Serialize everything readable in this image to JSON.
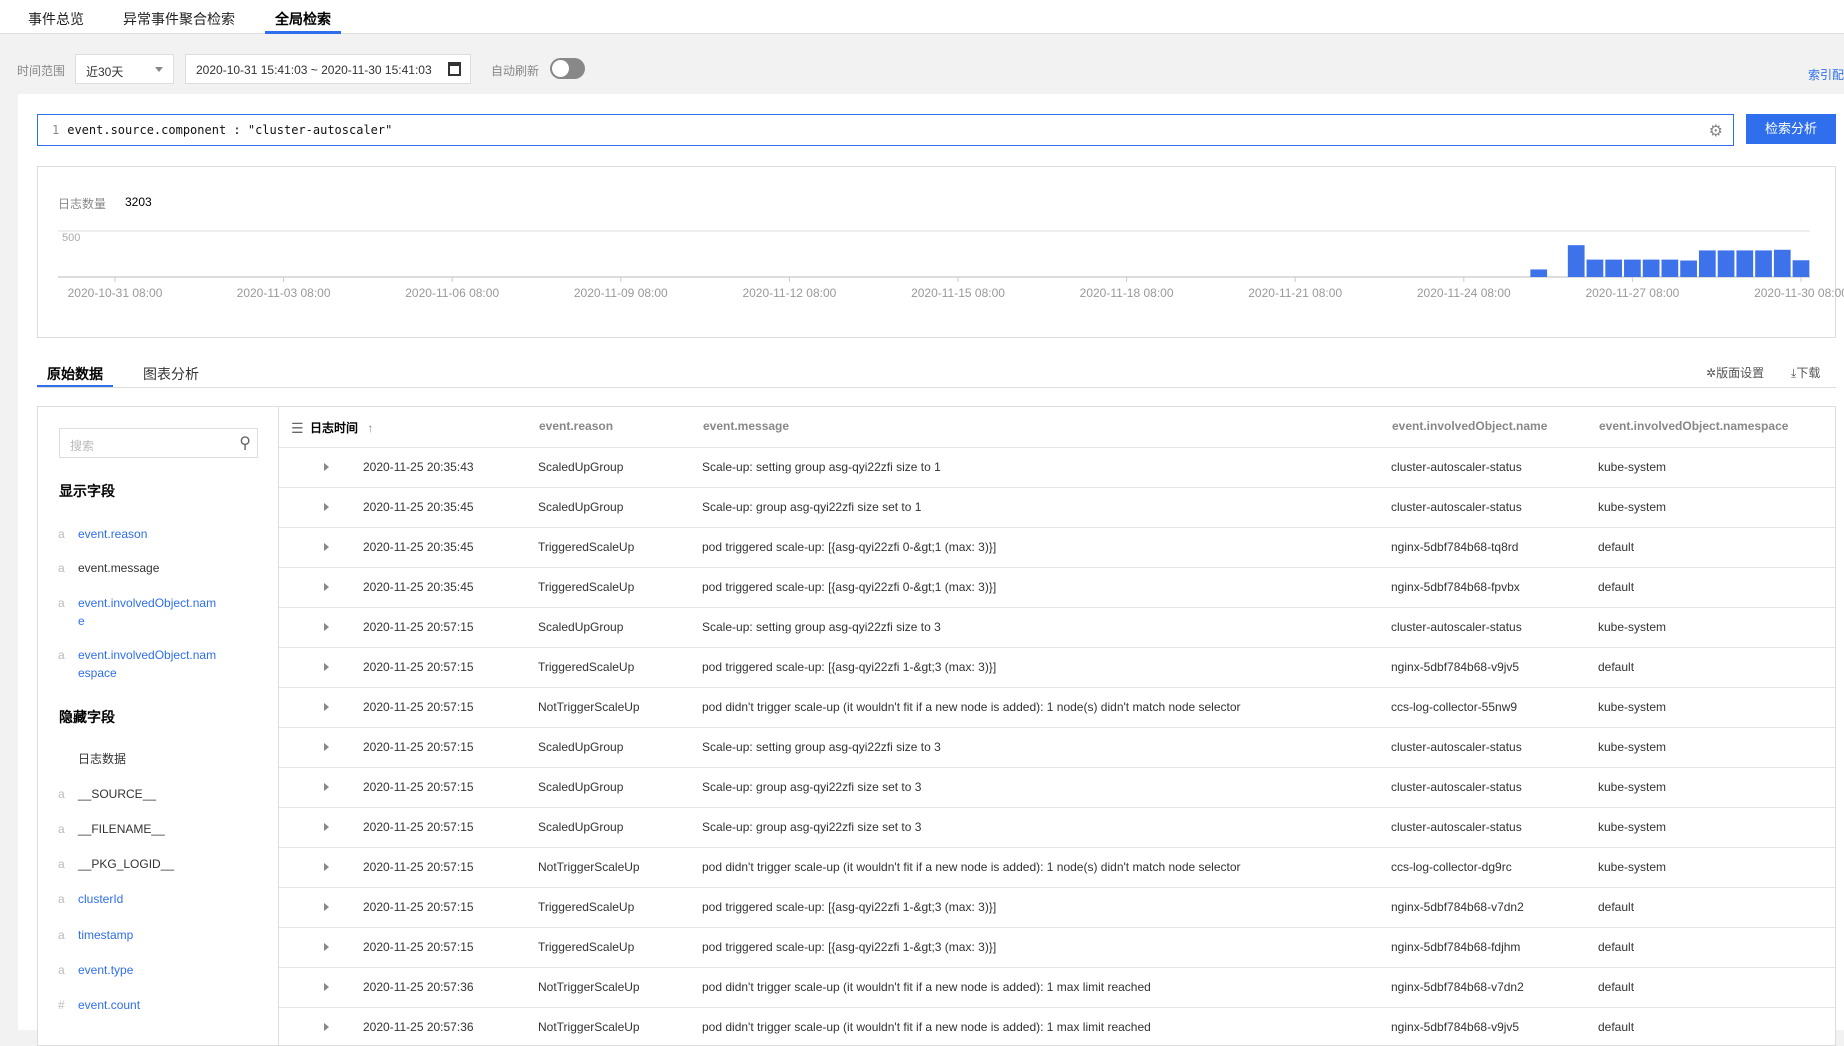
{
  "top_tabs": [
    {
      "label": "事件总览"
    },
    {
      "label": "异常事件聚合检索"
    },
    {
      "label": "全局检索",
      "active": true
    }
  ],
  "filter": {
    "time_label": "时间范围",
    "range_select": "近30天",
    "date_range": "2020-10-31 15:41:03 ~ 2020-11-30 15:41:03",
    "auto_refresh_label": "自动刷新",
    "auto_refresh_on": false,
    "index_link": "索引配"
  },
  "query": {
    "line_no": "1",
    "text": "event.source.component : \"cluster-autoscaler\"",
    "search_button": "检索分析"
  },
  "summary": {
    "count_label": "日志数量",
    "count": "3203"
  },
  "chart_data": {
    "type": "bar",
    "ylabel": "",
    "xlabel": "",
    "y_ticks": [
      500
    ],
    "grid": true,
    "x_tick_labels": [
      "2020-10-31 08:00",
      "2020-11-03 08:00",
      "2020-11-06 08:00",
      "2020-11-09 08:00",
      "2020-11-12 08:00",
      "2020-11-15 08:00",
      "2020-11-18 08:00",
      "2020-11-21 08:00",
      "2020-11-24 08:00",
      "2020-11-27 08:00",
      "2020-11-30 08:00"
    ],
    "x": [
      "2020-11-25 12:00",
      "2020-11-25 20:00",
      "2020-11-26 04:00",
      "2020-11-26 12:00",
      "2020-11-26 20:00",
      "2020-11-27 04:00",
      "2020-11-27 12:00",
      "2020-11-27 20:00",
      "2020-11-28 04:00",
      "2020-11-28 12:00",
      "2020-11-28 20:00",
      "2020-11-29 04:00",
      "2020-11-29 12:00",
      "2020-11-29 20:00",
      "2020-11-30 04:00"
    ],
    "values": [
      82,
      0,
      346,
      189,
      189,
      189,
      189,
      189,
      179,
      289,
      289,
      289,
      289,
      296,
      182
    ],
    "color": "#3d72eb"
  },
  "view_tabs": [
    {
      "label": "原始数据",
      "active": true
    },
    {
      "label": "图表分析"
    }
  ],
  "actions": {
    "layout_settings": "版面设置",
    "download": "下载"
  },
  "sidebar": {
    "search_placeholder": "搜索",
    "shown_title": "显示字段",
    "shown": [
      {
        "type": "a",
        "name": "event.reason",
        "active": true
      },
      {
        "type": "a",
        "name": "event.message",
        "active": false
      },
      {
        "type": "a",
        "name": "event.involvedObject.name",
        "active": true
      },
      {
        "type": "a",
        "name": "event.involvedObject.namespace",
        "active": true
      }
    ],
    "hidden_title": "隐藏字段",
    "hidden": [
      {
        "type": "",
        "name": "日志数据",
        "active": false
      },
      {
        "type": "a",
        "name": "__SOURCE__",
        "active": false
      },
      {
        "type": "a",
        "name": "__FILENAME__",
        "active": false
      },
      {
        "type": "a",
        "name": "__PKG_LOGID__",
        "active": false
      },
      {
        "type": "a",
        "name": "clusterId",
        "active": true
      },
      {
        "type": "a",
        "name": "timestamp",
        "active": true
      },
      {
        "type": "a",
        "name": "event.type",
        "active": true
      },
      {
        "type": "#",
        "name": "event.count",
        "active": true
      }
    ]
  },
  "table": {
    "columns": [
      "日志时间",
      "event.reason",
      "event.message",
      "event.involvedObject.name",
      "event.involvedObject.namespace"
    ],
    "sort_icon": "arrow-up",
    "rows": [
      [
        "2020-11-25 20:35:43",
        "ScaledUpGroup",
        "Scale-up: setting group asg-qyi22zfi size to 1",
        "cluster-autoscaler-status",
        "kube-system"
      ],
      [
        "2020-11-25 20:35:45",
        "ScaledUpGroup",
        "Scale-up: group asg-qyi22zfi size set to 1",
        "cluster-autoscaler-status",
        "kube-system"
      ],
      [
        "2020-11-25 20:35:45",
        "TriggeredScaleUp",
        "pod triggered scale-up: [{asg-qyi22zfi 0-&gt;1 (max: 3)}]",
        "nginx-5dbf784b68-tq8rd",
        "default"
      ],
      [
        "2020-11-25 20:35:45",
        "TriggeredScaleUp",
        "pod triggered scale-up: [{asg-qyi22zfi 0-&gt;1 (max: 3)}]",
        "nginx-5dbf784b68-fpvbx",
        "default"
      ],
      [
        "2020-11-25 20:57:15",
        "ScaledUpGroup",
        "Scale-up: setting group asg-qyi22zfi size to 3",
        "cluster-autoscaler-status",
        "kube-system"
      ],
      [
        "2020-11-25 20:57:15",
        "TriggeredScaleUp",
        "pod triggered scale-up: [{asg-qyi22zfi 1-&gt;3 (max: 3)}]",
        "nginx-5dbf784b68-v9jv5",
        "default"
      ],
      [
        "2020-11-25 20:57:15",
        "NotTriggerScaleUp",
        "pod didn't trigger scale-up (it wouldn't fit if a new node is added): 1 node(s) didn't match node selector",
        "ccs-log-collector-55nw9",
        "kube-system"
      ],
      [
        "2020-11-25 20:57:15",
        "ScaledUpGroup",
        "Scale-up: setting group asg-qyi22zfi size to 3",
        "cluster-autoscaler-status",
        "kube-system"
      ],
      [
        "2020-11-25 20:57:15",
        "ScaledUpGroup",
        "Scale-up: group asg-qyi22zfi size set to 3",
        "cluster-autoscaler-status",
        "kube-system"
      ],
      [
        "2020-11-25 20:57:15",
        "ScaledUpGroup",
        "Scale-up: group asg-qyi22zfi size set to 3",
        "cluster-autoscaler-status",
        "kube-system"
      ],
      [
        "2020-11-25 20:57:15",
        "NotTriggerScaleUp",
        "pod didn't trigger scale-up (it wouldn't fit if a new node is added): 1 node(s) didn't match node selector",
        "ccs-log-collector-dg9rc",
        "kube-system"
      ],
      [
        "2020-11-25 20:57:15",
        "TriggeredScaleUp",
        "pod triggered scale-up: [{asg-qyi22zfi 1-&gt;3 (max: 3)}]",
        "nginx-5dbf784b68-v7dn2",
        "default"
      ],
      [
        "2020-11-25 20:57:15",
        "TriggeredScaleUp",
        "pod triggered scale-up: [{asg-qyi22zfi 1-&gt;3 (max: 3)}]",
        "nginx-5dbf784b68-fdjhm",
        "default"
      ],
      [
        "2020-11-25 20:57:36",
        "NotTriggerScaleUp",
        "pod didn't trigger scale-up (it wouldn't fit if a new node is added): 1 max limit reached",
        "nginx-5dbf784b68-v7dn2",
        "default"
      ],
      [
        "2020-11-25 20:57:36",
        "NotTriggerScaleUp",
        "pod didn't trigger scale-up (it wouldn't fit if a new node is added): 1 max limit reached",
        "nginx-5dbf784b68-v9jv5",
        "default"
      ]
    ]
  }
}
